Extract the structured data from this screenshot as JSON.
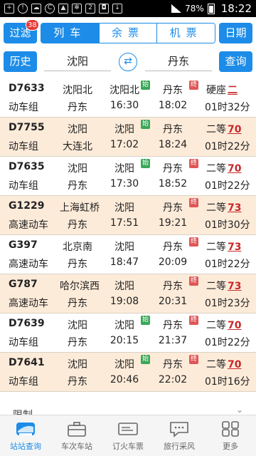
{
  "status_bar": {
    "battery": "78%",
    "time": "18:22",
    "notification_count": "2"
  },
  "toolbar": {
    "filter_label": "过滤",
    "filter_badge": "38",
    "tabs": [
      {
        "label": "列车",
        "active": true
      },
      {
        "label": "余票",
        "active": false
      },
      {
        "label": "机票",
        "active": false
      }
    ],
    "date_label": "日期"
  },
  "stations": {
    "history_label": "历史",
    "from": "沈阳",
    "to": "丹东",
    "swap_icon": "swap-icon",
    "query_label": "查询"
  },
  "trains": [
    {
      "number": "D7633",
      "type": "动车组",
      "origin": "沈阳北",
      "terminal": "丹东",
      "dep_station": "沈阳北",
      "dep_time": "16:30",
      "dep_badge": "始",
      "arr_station": "丹东",
      "arr_time": "18:02",
      "arr_badge": "终",
      "seat_class": "硬座",
      "seat_count": "二",
      "duration": "01时32分"
    },
    {
      "number": "D7755",
      "type": "动车组",
      "origin": "沈阳",
      "terminal": "大连北",
      "dep_station": "沈阳",
      "dep_time": "17:02",
      "dep_badge": "始",
      "arr_station": "丹东",
      "arr_time": "18:24",
      "arr_badge": "",
      "seat_class": "二等",
      "seat_count": "70",
      "duration": "01时22分"
    },
    {
      "number": "D7635",
      "type": "动车组",
      "origin": "沈阳",
      "terminal": "丹东",
      "dep_station": "沈阳",
      "dep_time": "17:30",
      "dep_badge": "始",
      "arr_station": "丹东",
      "arr_time": "18:52",
      "arr_badge": "终",
      "seat_class": "二等",
      "seat_count": "70",
      "duration": "01时22分"
    },
    {
      "number": "G1229",
      "type": "高速动车",
      "origin": "上海虹桥",
      "terminal": "丹东",
      "dep_station": "沈阳",
      "dep_time": "17:51",
      "dep_badge": "",
      "arr_station": "丹东",
      "arr_time": "19:21",
      "arr_badge": "终",
      "seat_class": "二等",
      "seat_count": "73",
      "duration": "01时30分"
    },
    {
      "number": "G397",
      "type": "高速动车",
      "origin": "北京南",
      "terminal": "丹东",
      "dep_station": "沈阳",
      "dep_time": "18:47",
      "dep_badge": "",
      "arr_station": "丹东",
      "arr_time": "20:09",
      "arr_badge": "终",
      "seat_class": "二等",
      "seat_count": "73",
      "duration": "01时22分"
    },
    {
      "number": "G787",
      "type": "高速动车",
      "origin": "哈尔滨西",
      "terminal": "丹东",
      "dep_station": "沈阳",
      "dep_time": "19:08",
      "dep_badge": "",
      "arr_station": "丹东",
      "arr_time": "20:31",
      "arr_badge": "终",
      "seat_class": "二等",
      "seat_count": "73",
      "duration": "01时23分"
    },
    {
      "number": "D7639",
      "type": "动车组",
      "origin": "沈阳",
      "terminal": "丹东",
      "dep_station": "沈阳",
      "dep_time": "20:15",
      "dep_badge": "始",
      "arr_station": "丹东",
      "arr_time": "21:37",
      "arr_badge": "终",
      "seat_class": "二等",
      "seat_count": "70",
      "duration": "01时22分"
    },
    {
      "number": "D7641",
      "type": "动车组",
      "origin": "沈阳",
      "terminal": "丹东",
      "dep_station": "沈阳",
      "dep_time": "20:46",
      "dep_badge": "始",
      "arr_station": "丹东",
      "arr_time": "22:02",
      "arr_badge": "终",
      "seat_class": "二等",
      "seat_count": "70",
      "duration": "01时16分"
    }
  ],
  "partial_row": {
    "label": "限制"
  },
  "bottom_nav": [
    {
      "label": "站站查询",
      "icon": "train-icon",
      "active": true
    },
    {
      "label": "车次车站",
      "icon": "briefcase-icon",
      "active": false
    },
    {
      "label": "订火车票",
      "icon": "ticket-icon",
      "active": false
    },
    {
      "label": "旅行采风",
      "icon": "chat-icon",
      "active": false
    },
    {
      "label": "更多",
      "icon": "grid-icon",
      "active": false
    }
  ],
  "colors": {
    "accent": "#1c8ce8",
    "row_alt": "#fdebd9",
    "seat_count": "#c62828"
  }
}
